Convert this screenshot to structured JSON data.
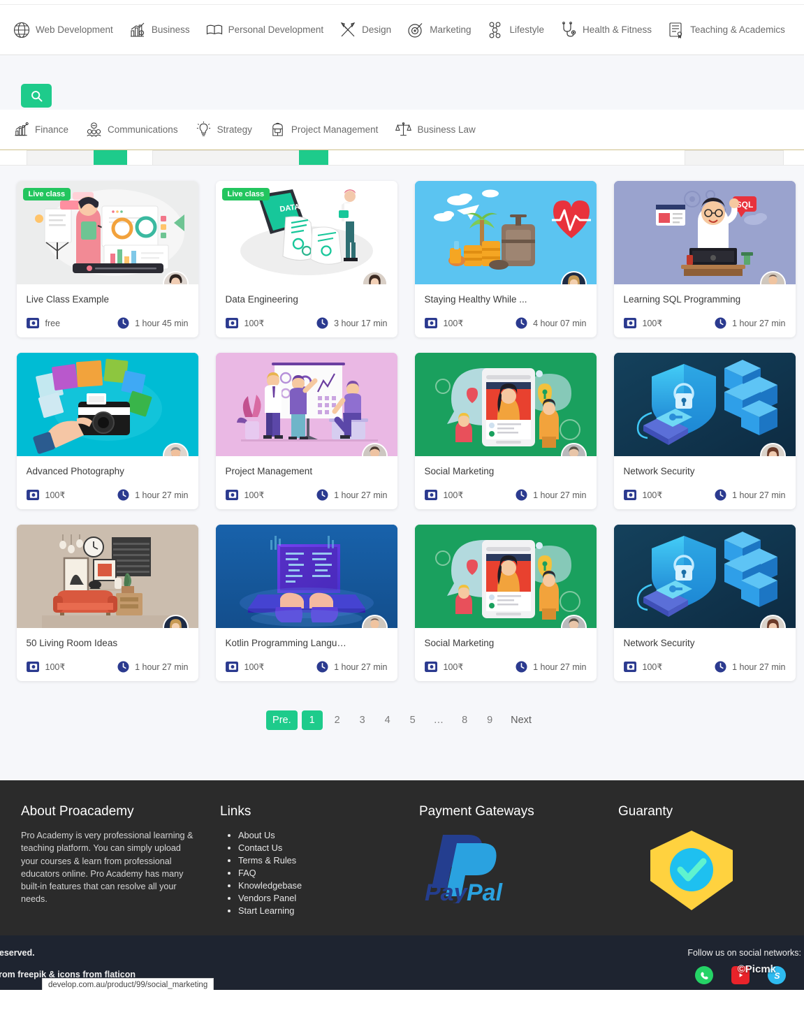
{
  "top_nav": {
    "items": [
      {
        "label": "Web Development",
        "icon": "globe-icon"
      },
      {
        "label": "Business",
        "icon": "bar-chart-dollar-icon"
      },
      {
        "label": "Personal Development",
        "icon": "open-book-icon"
      },
      {
        "label": "Design",
        "icon": "pencil-ruler-icon"
      },
      {
        "label": "Marketing",
        "icon": "target-pen-icon"
      },
      {
        "label": "Lifestyle",
        "icon": "molecule-icon"
      },
      {
        "label": "Health & Fitness",
        "icon": "stethoscope-icon"
      },
      {
        "label": "Teaching & Academics",
        "icon": "certificate-icon"
      }
    ]
  },
  "search": {
    "button_icon": "search-icon",
    "accent_color": "#1ecb8b"
  },
  "sub_nav": {
    "items": [
      {
        "label": "Finance",
        "icon": "growth-chart-icon"
      },
      {
        "label": "Communications",
        "icon": "people-group-icon"
      },
      {
        "label": "Strategy",
        "icon": "lightbulb-icon"
      },
      {
        "label": "Project Management",
        "icon": "backpack-gear-icon"
      },
      {
        "label": "Business Law",
        "icon": "scales-icon"
      }
    ]
  },
  "courses": [
    {
      "title": "Live Class Example",
      "price": "free",
      "duration": "1 hour 45 min",
      "badge": "Live class",
      "thumb_bg": "#eceded",
      "thumb_art": "live-class-woman-presenting",
      "avatar": "avatar-woman-dark-hair",
      "price_icon": "wallet-icon",
      "duration_icon": "clock-icon"
    },
    {
      "title": "Data Engineering",
      "price": "100₹",
      "duration": "3 hour 17 min",
      "badge": "Live class",
      "thumb_bg": "#ffffff",
      "thumb_art": "data-phone-isometric",
      "avatar": "avatar-woman-brown-hair",
      "price_icon": "wallet-icon",
      "duration_icon": "clock-icon"
    },
    {
      "title": "Staying Healthy While ...",
      "price": "100₹",
      "duration": "4 hour 07 min",
      "badge": null,
      "thumb_bg": "#5bc4f1",
      "thumb_art": "travel-luggage-heart",
      "avatar": "avatar-woman-blonde",
      "price_icon": "wallet-icon",
      "duration_icon": "clock-icon"
    },
    {
      "title": "Learning SQL Programming",
      "price": "100₹",
      "duration": "1 hour 27 min",
      "badge": null,
      "thumb_bg": "#9aa3ce",
      "thumb_art": "sql-developer-laptop",
      "avatar": "avatar-man-purple-shirt",
      "price_icon": "wallet-icon",
      "duration_icon": "clock-icon"
    },
    {
      "title": "Advanced Photography",
      "price": "100₹",
      "duration": "1 hour 27 min",
      "badge": null,
      "thumb_bg": "#00bcd4",
      "thumb_art": "camera-photos",
      "avatar": "avatar-man-pink-shirt",
      "price_icon": "wallet-icon",
      "duration_icon": "clock-icon"
    },
    {
      "title": "Project Management",
      "price": "100₹",
      "duration": "1 hour 27 min",
      "badge": null,
      "thumb_bg": "#eab8e4",
      "thumb_art": "team-whiteboard-meeting",
      "avatar": "avatar-man-dark-jacket",
      "price_icon": "wallet-icon",
      "duration_icon": "clock-icon"
    },
    {
      "title": "Social Marketing",
      "price": "100₹",
      "duration": "1 hour 27 min",
      "badge": null,
      "thumb_bg": "#1aa05e",
      "thumb_art": "social-phone-influencer",
      "avatar": "avatar-man-grey-shirt",
      "price_icon": "wallet-icon",
      "duration_icon": "clock-icon"
    },
    {
      "title": "Network Security",
      "price": "100₹",
      "duration": "1 hour 27 min",
      "badge": null,
      "thumb_bg": "#1b4a63",
      "thumb_art": "shield-lock-servers",
      "avatar": "avatar-woman-red-hair",
      "price_icon": "wallet-icon",
      "duration_icon": "clock-icon"
    },
    {
      "title": "50 Living Room Ideas",
      "price": "100₹",
      "duration": "1 hour 27 min",
      "badge": null,
      "thumb_bg": "#cbbdae",
      "thumb_art": "living-room-interior",
      "avatar": "avatar-woman-blonde",
      "price_icon": "wallet-icon",
      "duration_icon": "clock-icon"
    },
    {
      "title": "Kotlin Programming Language",
      "price": "100₹",
      "duration": "1 hour 27 min",
      "badge": null,
      "thumb_bg": "#17599c",
      "thumb_art": "laptop-coding-hands",
      "avatar": "avatar-man-purple-shirt",
      "price_icon": "wallet-icon",
      "duration_icon": "clock-icon"
    },
    {
      "title": "Social Marketing",
      "price": "100₹",
      "duration": "1 hour 27 min",
      "badge": null,
      "thumb_bg": "#1aa05e",
      "thumb_art": "social-phone-influencer",
      "avatar": "avatar-man-grey-shirt",
      "price_icon": "wallet-icon",
      "duration_icon": "clock-icon"
    },
    {
      "title": "Network Security",
      "price": "100₹",
      "duration": "1 hour 27 min",
      "badge": null,
      "thumb_bg": "#1b4a63",
      "thumb_art": "shield-lock-servers",
      "avatar": "avatar-woman-red-hair",
      "price_icon": "wallet-icon",
      "duration_icon": "clock-icon"
    }
  ],
  "pagination": {
    "prev_label": "Pre.",
    "next_label": "Next",
    "pages": [
      "1",
      "2",
      "3",
      "4",
      "5",
      "…",
      "8",
      "9"
    ],
    "active": "1"
  },
  "footer": {
    "about": {
      "heading": "About Proacademy",
      "text": "Pro Academy is very professional learning & teaching platform. You can simply upload your courses & learn from professional educators online. Pro Academy has many built-in features that can resolve all your needs."
    },
    "links": {
      "heading": "Links",
      "items": [
        "About Us",
        "Contact Us",
        "Terms & Rules",
        "FAQ",
        "Knowledgebase",
        "Vendors Panel",
        "Start Learning"
      ]
    },
    "payments": {
      "heading": "Payment Gateways",
      "logo": "paypal-logo",
      "logo_text_pay": "Pay",
      "logo_text_pal": "Pal"
    },
    "guaranty": {
      "heading": "Guaranty",
      "icon": "shield-check-icon"
    }
  },
  "bottom_bar": {
    "copyright_fragment": "reserved.",
    "credits_fragment": "from freepik & icons from flaticon",
    "follow_label": "Follow us on social networks:",
    "watermark": "©Picmk",
    "status_tip": "develop.com.au/product/99/social_marketing",
    "socials": [
      {
        "name": "whatsapp-icon"
      },
      {
        "name": "youtube-icon"
      },
      {
        "name": "skype-icon"
      }
    ]
  }
}
